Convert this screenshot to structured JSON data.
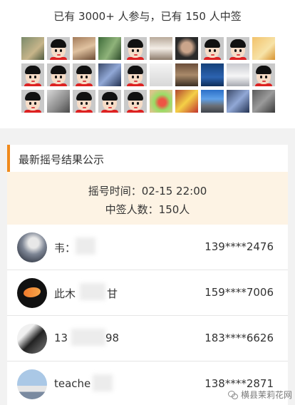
{
  "summary": {
    "text": "已有 3000+ 人参与，已有 150 人中签"
  },
  "avatars": [
    "photo-a",
    "default",
    "photo-b",
    "photo-c",
    "default",
    "photo-d",
    "photo-e",
    "default",
    "default",
    "photo-n",
    "default",
    "default",
    "default",
    "photo-g",
    "default",
    "photo-o",
    "photo-h",
    "photo-m",
    "photo-i",
    "default",
    "default",
    "photo-p",
    "default",
    "default",
    "default",
    "photo-f",
    "photo-l",
    "photo-k",
    "photo-g",
    "photo-j"
  ],
  "results": {
    "title": "最新摇号结果公示",
    "draw_time": "摇号时间：02-15 22:00",
    "winner_count": "中签人数：150人",
    "rows": [
      {
        "name": "韦：",
        "phone": "139****2476"
      },
      {
        "name": "此木",
        "name_tail": "甘",
        "phone": "159****7006"
      },
      {
        "name": "13",
        "name_tail": "98",
        "phone": "183****6626"
      },
      {
        "name": "teache",
        "phone": "138****2871"
      }
    ]
  },
  "watermark": {
    "text": "横县茉莉花网"
  }
}
